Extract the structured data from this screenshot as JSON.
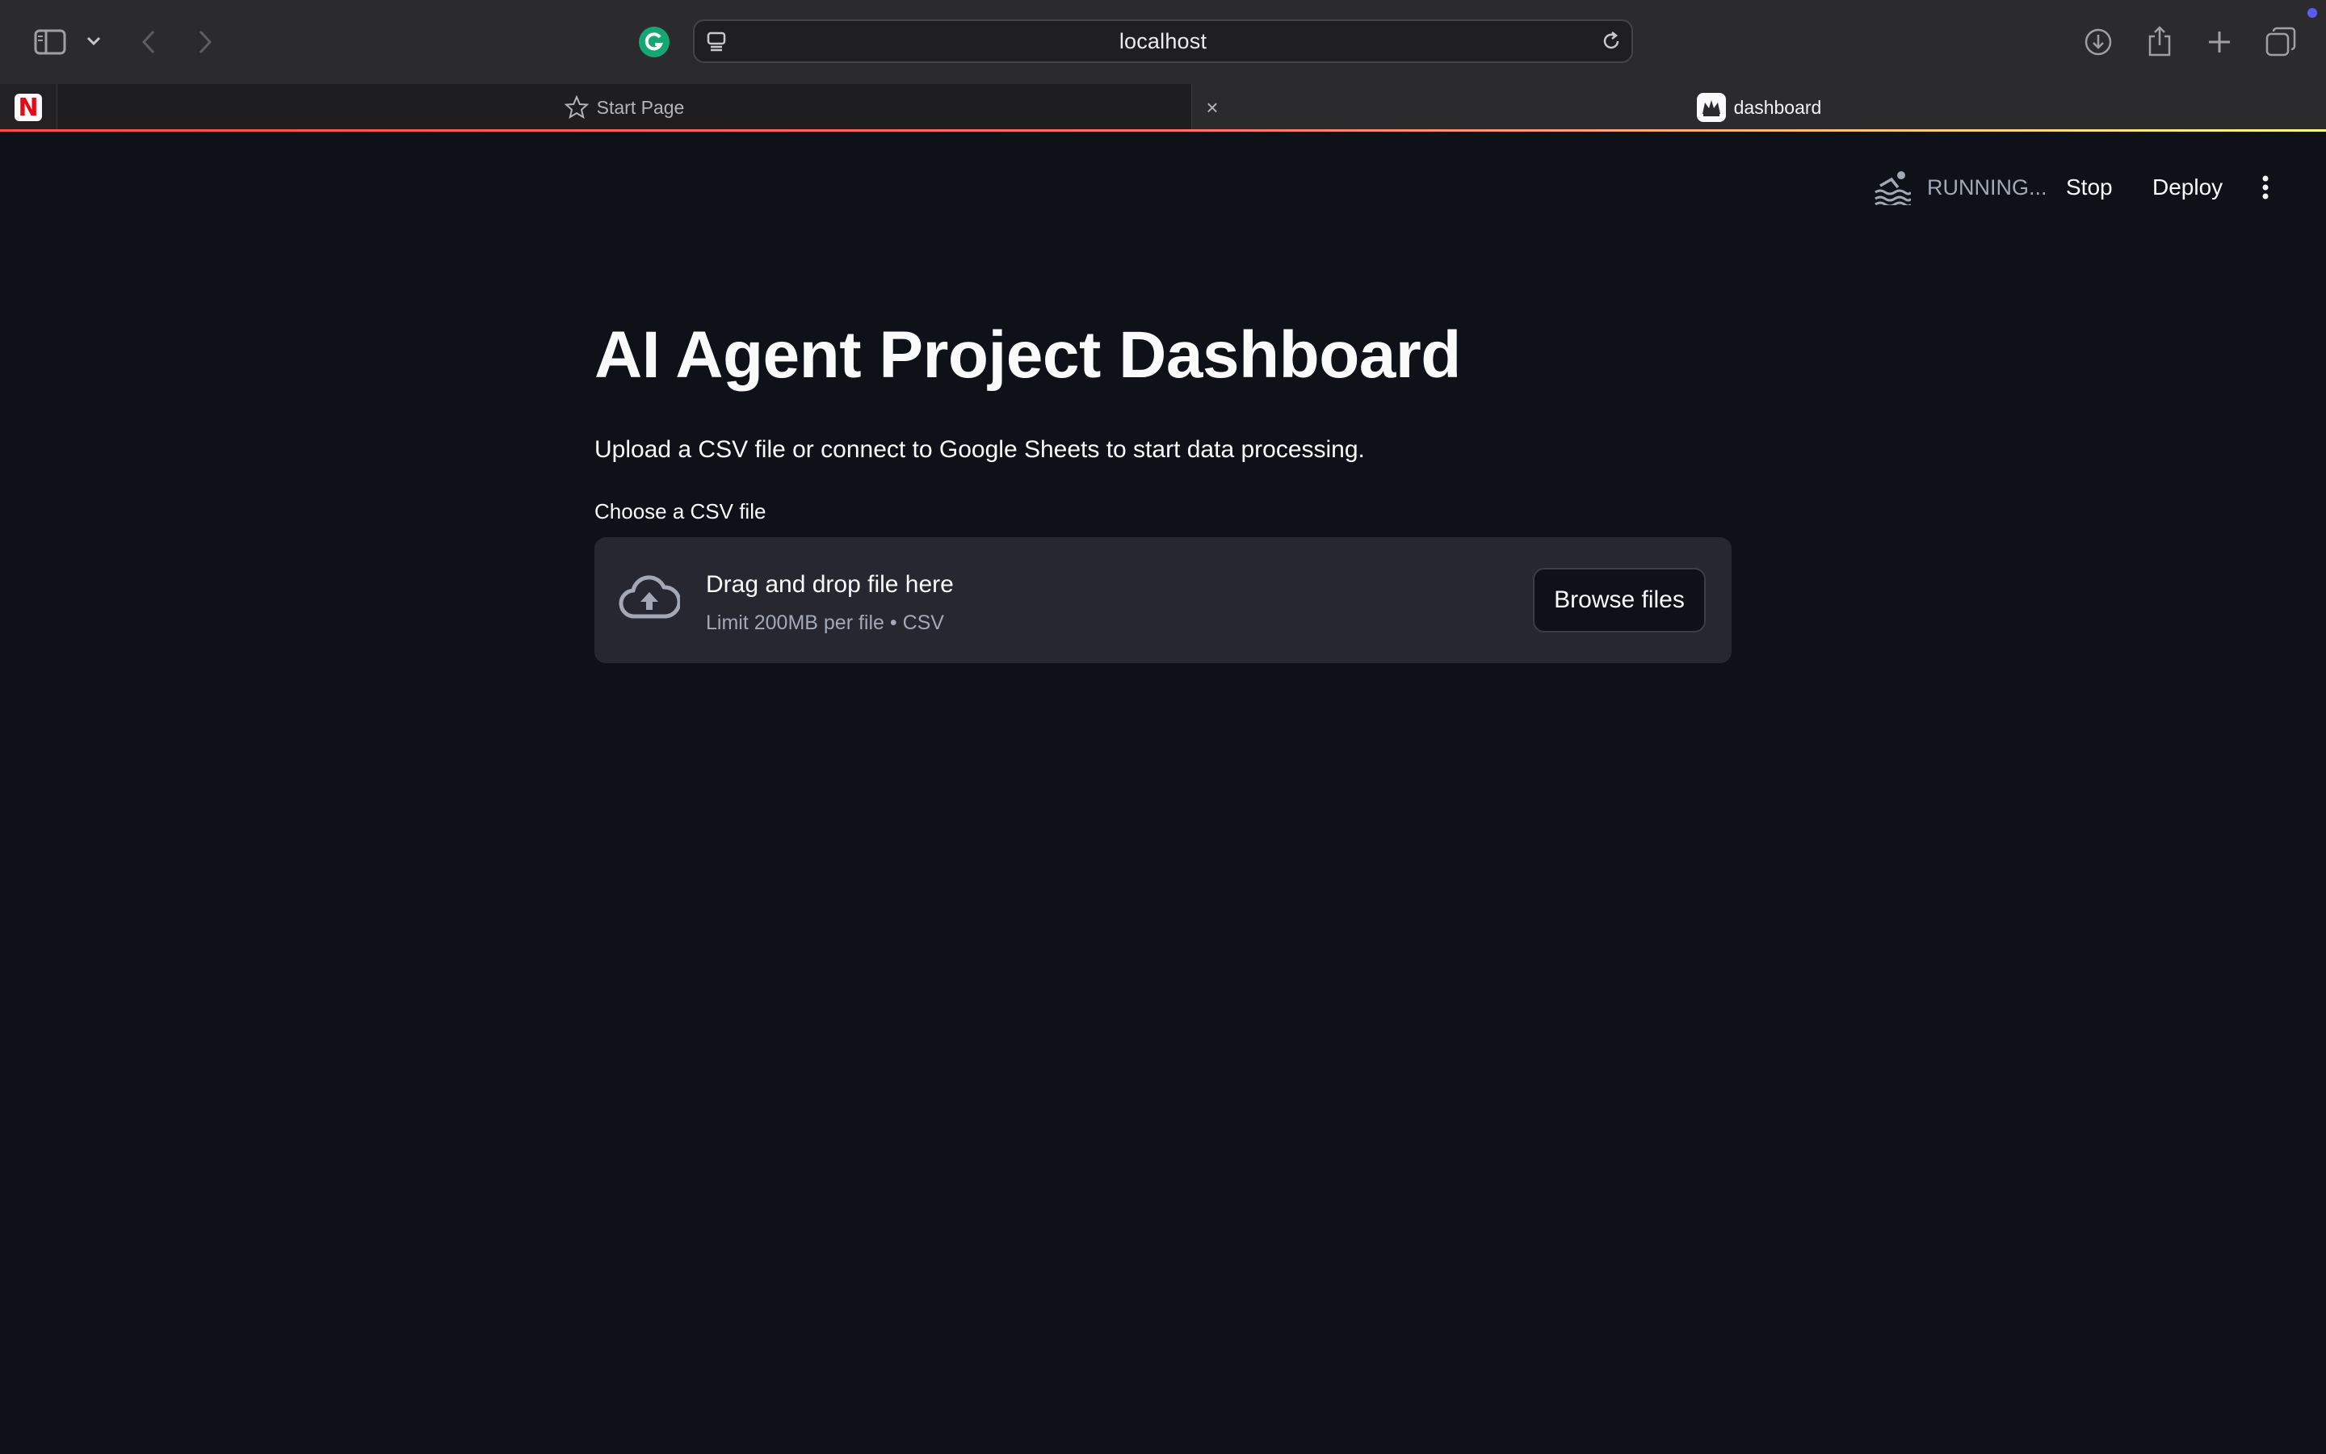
{
  "browser": {
    "url": "localhost",
    "tabs": [
      {
        "label": "",
        "icon": "netflix-icon",
        "pinned": true
      },
      {
        "label": "Start Page",
        "icon": "star-icon"
      },
      {
        "label": "dashboard",
        "icon": "streamlit-icon",
        "active": true
      }
    ],
    "close_glyph": "×"
  },
  "header": {
    "status": "RUNNING...",
    "stop_label": "Stop",
    "deploy_label": "Deploy"
  },
  "main": {
    "title": "AI Agent Project Dashboard",
    "subtitle": "Upload a CSV file or connect to Google Sheets to start data processing.",
    "uploader": {
      "label": "Choose a CSV file",
      "drop_text": "Drag and drop file here",
      "limit_text": "Limit 200MB per file • CSV",
      "browse_label": "Browse files"
    }
  },
  "colors": {
    "background": "#0e1117",
    "surface": "#262730",
    "accent": "#ff4b4b",
    "muted_text": "#a3a8b8"
  }
}
